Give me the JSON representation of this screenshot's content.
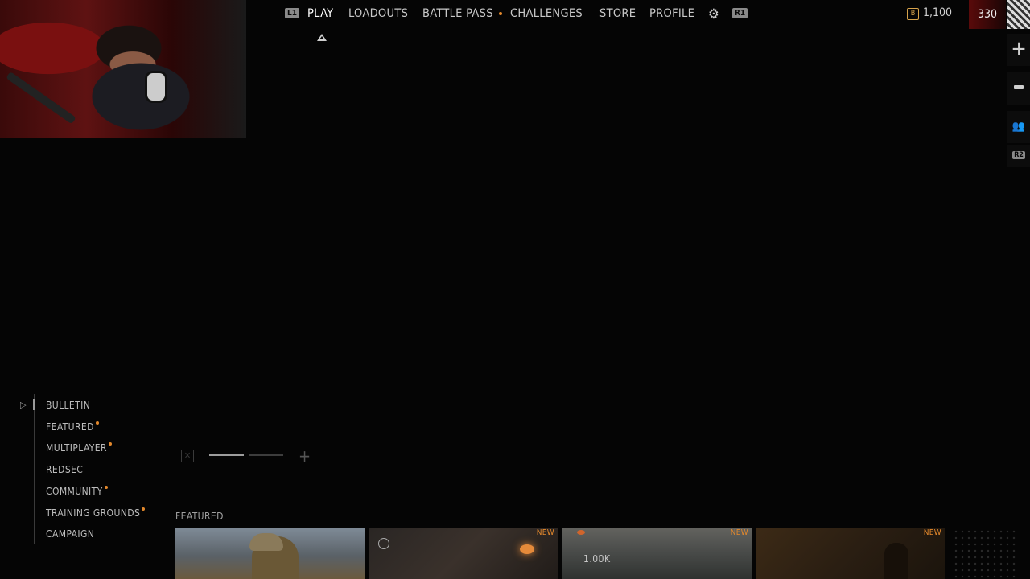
{
  "webcam": {
    "description": "streamer webcam overlay"
  },
  "topnav": {
    "left_hint": "L1",
    "right_hint": "R1",
    "items": [
      {
        "label": "PLAY",
        "active": true
      },
      {
        "label": "LOADOUTS"
      },
      {
        "label": "BATTLE PASS",
        "notification": true
      },
      {
        "label": "CHALLENGES"
      },
      {
        "label": "STORE"
      },
      {
        "label": "PROFILE"
      }
    ],
    "settings_icon": "gear-icon",
    "currency_icon": "B",
    "currency_value": "1,100",
    "level": "330"
  },
  "rail": {
    "plus_icon": "+",
    "minus_icon": "minus-icon",
    "people_icon": "party-icon",
    "r2_hint": "R2"
  },
  "menu": {
    "items": [
      {
        "label": "BULLETIN",
        "active": true
      },
      {
        "label": "FEATURED",
        "notification": true
      },
      {
        "label": "MULTIPLAYER",
        "notification": true
      },
      {
        "label": "REDSEC"
      },
      {
        "label": "COMMUNITY",
        "notification": true
      },
      {
        "label": "TRAINING GROUNDS",
        "notification": true
      },
      {
        "label": "CAMPAIGN"
      }
    ]
  },
  "carousel": {
    "total_pages": 2,
    "current_page": 1,
    "plus_icon": "+"
  },
  "featured": {
    "heading": "FEATURED",
    "cards": [
      {
        "badge": ""
      },
      {
        "badge": "NEW"
      },
      {
        "badge": "NEW",
        "stat": "1.00K"
      },
      {
        "badge": "NEW"
      }
    ]
  },
  "colors": {
    "accent": "#e3882c",
    "background": "#050505",
    "level_red": "#5a0a0a",
    "currency_gold": "#d6a24a"
  }
}
